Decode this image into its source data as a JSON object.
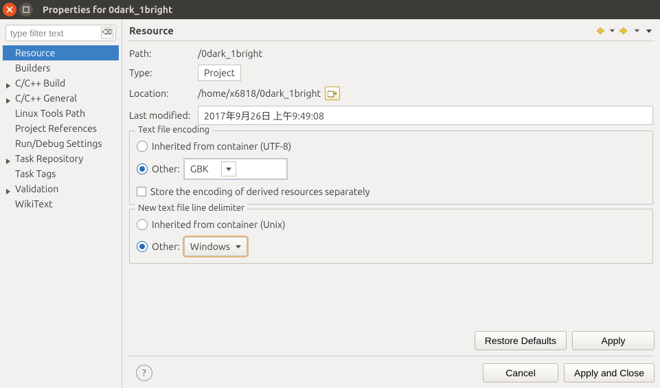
{
  "window": {
    "title": "Properties for 0dark_1bright"
  },
  "sidebar": {
    "filter_placeholder": "type filter text",
    "items": [
      {
        "label": "Resource",
        "selected": true,
        "expandable": false
      },
      {
        "label": "Builders",
        "expandable": false
      },
      {
        "label": "C/C++ Build",
        "expandable": true
      },
      {
        "label": "C/C++ General",
        "expandable": true
      },
      {
        "label": "Linux Tools Path",
        "expandable": false
      },
      {
        "label": "Project References",
        "expandable": false
      },
      {
        "label": "Run/Debug Settings",
        "expandable": false
      },
      {
        "label": "Task Repository",
        "expandable": true
      },
      {
        "label": "Task Tags",
        "expandable": false
      },
      {
        "label": "Validation",
        "expandable": true
      },
      {
        "label": "WikiText",
        "expandable": false
      }
    ]
  },
  "main": {
    "heading": "Resource",
    "path_label": "Path:",
    "path_value": "/0dark_1bright",
    "type_label": "Type:",
    "type_value": "Project",
    "location_label": "Location:",
    "location_value": "/home/x6818/0dark_1bright",
    "last_modified_label": "Last modified:",
    "last_modified_value": "2017年9月26日 上午9:49:08",
    "encoding_group": {
      "legend": "Text file encoding",
      "inherited_label": "Inherited from container (UTF-8)",
      "other_label": "Other:",
      "other_value": "GBK",
      "store_label": "Store the encoding of derived resources separately"
    },
    "delimiter_group": {
      "legend": "New text file line delimiter",
      "inherited_label": "Inherited from container (Unix)",
      "other_label": "Other:",
      "other_value": "Windows"
    },
    "buttons": {
      "restore": "Restore Defaults",
      "apply": "Apply",
      "cancel": "Cancel",
      "apply_close": "Apply and Close"
    }
  }
}
